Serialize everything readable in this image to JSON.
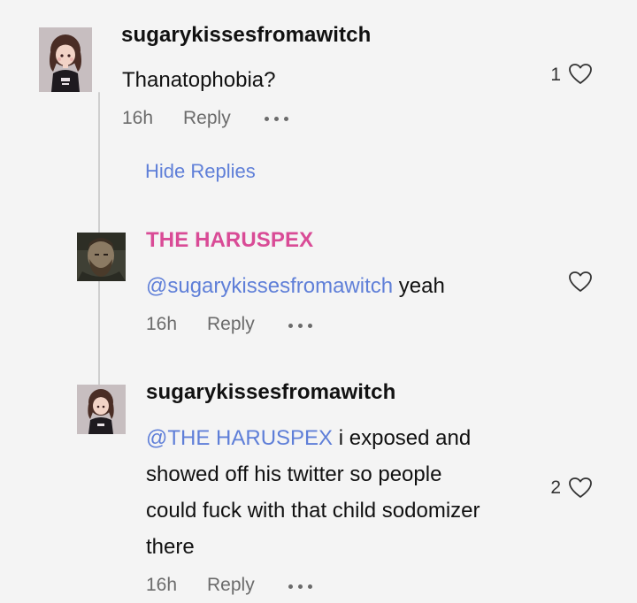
{
  "comments": [
    {
      "username": "sugarykissesfromawitch",
      "text": "Thanatophobia?",
      "time": "16h",
      "reply_label": "Reply",
      "likes": "1",
      "avatar_icon": "avatar-anime-girl",
      "hide_replies_label": "Hide Replies"
    }
  ],
  "replies": [
    {
      "username": "THE HARUSPEX",
      "username_color": "#d94b96",
      "mention": "@sugarykissesfromawitch",
      "text": "yeah",
      "time": "16h",
      "reply_label": "Reply",
      "likes": "",
      "avatar_icon": "avatar-bearded-man"
    },
    {
      "username": "sugarykissesfromawitch",
      "mention": "@THE HARUSPEX",
      "text_lines": [
        "i exposed and",
        "showed off his twitter so people",
        "could fuck with that child sodomizer",
        "there"
      ],
      "time": "16h",
      "reply_label": "Reply",
      "likes": "2",
      "avatar_icon": "avatar-anime-girl"
    }
  ],
  "colors": {
    "background": "#f4f4f4",
    "mention": "#5f7fd8",
    "meta": "#6b6b6b",
    "thread_line": "#cfcfcf"
  }
}
